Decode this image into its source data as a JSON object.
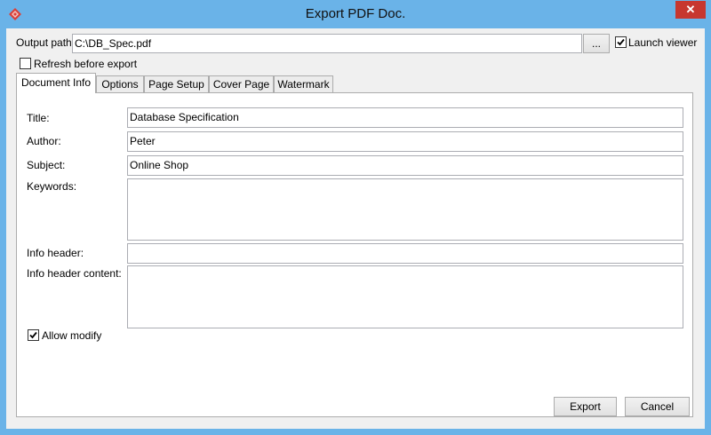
{
  "window": {
    "title": "Export PDF Doc.",
    "close_glyph": "✕",
    "accent": "#6ab3e8"
  },
  "top": {
    "output_path_label": "Output path:",
    "output_path_value": "C:\\DB_Spec.pdf",
    "browse_label": "...",
    "launch_viewer_label": "Launch viewer",
    "launch_viewer_checked": true,
    "refresh_label": "Refresh before export",
    "refresh_checked": false
  },
  "tabs": [
    {
      "label": "Document Info",
      "active": true
    },
    {
      "label": "Options",
      "active": false
    },
    {
      "label": "Page Setup",
      "active": false
    },
    {
      "label": "Cover Page",
      "active": false
    },
    {
      "label": "Watermark",
      "active": false
    }
  ],
  "doc_info": {
    "title_label": "Title:",
    "title_value": "Database Specification",
    "author_label": "Author:",
    "author_value": "Peter",
    "subject_label": "Subject:",
    "subject_value": "Online Shop",
    "keywords_label": "Keywords:",
    "keywords_value": "",
    "info_header_label": "Info header:",
    "info_header_value": "",
    "info_header_content_label": "Info header content:",
    "info_header_content_value": "",
    "allow_modify_label": "Allow modify",
    "allow_modify_checked": true
  },
  "footer": {
    "export_label": "Export",
    "cancel_label": "Cancel"
  }
}
